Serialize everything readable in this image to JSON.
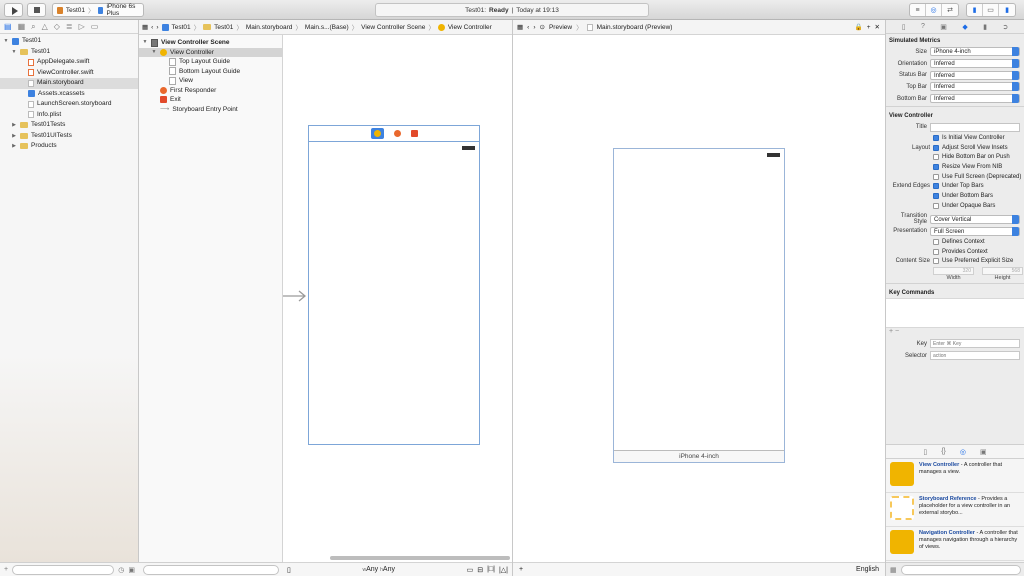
{
  "toolbar": {
    "scheme_app": "Test01",
    "scheme_device": "iPhone 6s Plus",
    "status_project": "Test01:",
    "status_state": "Ready",
    "status_sep": "|",
    "status_time": "Today at 19:13"
  },
  "navigator": {
    "items": [
      {
        "label": "Test01",
        "level": 0,
        "kind": "project",
        "expanded": true
      },
      {
        "label": "Test01",
        "level": 1,
        "kind": "folder",
        "expanded": true
      },
      {
        "label": "AppDelegate.swift",
        "level": 2,
        "kind": "swift"
      },
      {
        "label": "ViewController.swift",
        "level": 2,
        "kind": "swift"
      },
      {
        "label": "Main.storyboard",
        "level": 2,
        "kind": "storyboard",
        "selected": true
      },
      {
        "label": "Assets.xcassets",
        "level": 2,
        "kind": "assets"
      },
      {
        "label": "LaunchScreen.storyboard",
        "level": 2,
        "kind": "storyboard"
      },
      {
        "label": "Info.plist",
        "level": 2,
        "kind": "plist"
      },
      {
        "label": "Test01Tests",
        "level": 1,
        "kind": "folder",
        "expanded": false
      },
      {
        "label": "Test01UITests",
        "level": 1,
        "kind": "folder",
        "expanded": false
      },
      {
        "label": "Products",
        "level": 1,
        "kind": "folder",
        "expanded": false
      }
    ]
  },
  "editor": {
    "jumpbar": [
      "Test01",
      "Test01",
      "Main.storyboard",
      "Main.s...(Base)",
      "View Controller Scene",
      "View Controller"
    ],
    "outline": [
      {
        "label": "View Controller Scene",
        "level": 0,
        "kind": "scene"
      },
      {
        "label": "View Controller",
        "level": 1,
        "kind": "vc",
        "selected": true
      },
      {
        "label": "Top Layout Guide",
        "level": 2,
        "kind": "guide"
      },
      {
        "label": "Bottom Layout Guide",
        "level": 2,
        "kind": "guide"
      },
      {
        "label": "View",
        "level": 2,
        "kind": "guide"
      },
      {
        "label": "First Responder",
        "level": 1,
        "kind": "responder"
      },
      {
        "label": "Exit",
        "level": 1,
        "kind": "exit"
      },
      {
        "label": "Storyboard Entry Point",
        "level": 1,
        "kind": "entry"
      }
    ],
    "size_class_w_prefix": "w",
    "size_class_w": "Any",
    "size_class_h_prefix": "h",
    "size_class_h": "Any"
  },
  "preview": {
    "jumpbar": [
      "Preview",
      "Main.storyboard (Preview)"
    ],
    "device_label": "iPhone 4-inch",
    "language": "English"
  },
  "inspector": {
    "simulated_metrics": {
      "title": "Simulated Metrics",
      "rows": [
        {
          "label": "Size",
          "value": "iPhone 4-inch"
        },
        {
          "label": "Orientation",
          "value": "Inferred"
        },
        {
          "label": "Status Bar",
          "value": "Inferred"
        },
        {
          "label": "Top Bar",
          "value": "Inferred"
        },
        {
          "label": "Bottom Bar",
          "value": "Inferred"
        }
      ]
    },
    "view_controller": {
      "title": "View Controller",
      "title_label": "Title",
      "is_initial": "Is Initial View Controller",
      "layout_label": "Layout",
      "layout_options": [
        {
          "label": "Adjust Scroll View Insets",
          "checked": true
        },
        {
          "label": "Hide Bottom Bar on Push",
          "checked": false
        },
        {
          "label": "Resize View From NIB",
          "checked": true
        },
        {
          "label": "Use Full Screen (Deprecated)",
          "checked": false
        }
      ],
      "extend_label": "Extend Edges",
      "extend_options": [
        {
          "label": "Under Top Bars",
          "checked": true
        },
        {
          "label": "Under Bottom Bars",
          "checked": true
        },
        {
          "label": "Under Opaque Bars",
          "checked": false
        }
      ],
      "transition_label": "Transition Style",
      "transition_value": "Cover Vertical",
      "presentation_label": "Presentation",
      "presentation_value": "Full Screen",
      "defines_context": "Defines Context",
      "provides_context": "Provides Context",
      "content_size_label": "Content Size",
      "use_preferred": "Use Preferred Explicit Size",
      "width_value": "320",
      "height_value": "568",
      "width_label": "Width",
      "height_label": "Height"
    },
    "key_commands": {
      "title": "Key Commands",
      "key_label": "Key",
      "key_placeholder": "Enter ⌘ Key",
      "selector_label": "Selector",
      "selector_placeholder": "action"
    },
    "library": [
      {
        "name": "View Controller",
        "desc": " - A controller that manages a view.",
        "color": "#f0b400"
      },
      {
        "name": "Storyboard Reference",
        "desc": " - Provides a placeholder for a view controller in an external storybo...",
        "color": "#f7c85a"
      },
      {
        "name": "Navigation Controller",
        "desc": " - A controller that manages navigation through a hierarchy of views.",
        "color": "#f0b400"
      }
    ]
  }
}
